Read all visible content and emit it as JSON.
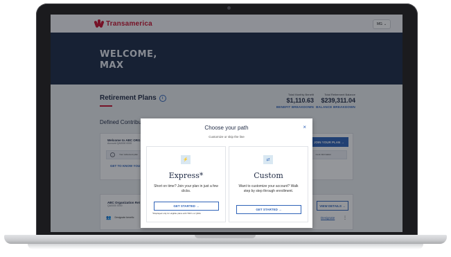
{
  "brand": {
    "name": "Transamerica",
    "accent": "#c8102e",
    "navy": "#1d2b45",
    "link_blue": "#2f63b8"
  },
  "header": {
    "user_initials": "MG",
    "user_chevron": "⌄"
  },
  "hero": {
    "title": "WELCOME, MAX"
  },
  "plans": {
    "title": "Retirement Plans",
    "info_glyph": "i",
    "monthly": {
      "label": "Total Monthly Benefit",
      "value": "$1,110.63",
      "link": "BENEFIT BREAKDOWN"
    },
    "balance": {
      "label": "Total Retirement Balance",
      "value": "$239,311.04",
      "link": "BALANCE BREAKDOWN"
    },
    "section_title": "Defined Contribut",
    "card1": {
      "title": "Welcome to ABC ORG",
      "subtitle": "Account QA0000 0000",
      "notice_left": "Your retirement plan",
      "notice_right": "ment information",
      "link": "GET TO KNOW YOU",
      "join_button": "JOIN YOUR PLAN →"
    },
    "card2": {
      "title": "ABC Organization Ret",
      "subtitle": "QA0000 0000",
      "row_text": "Designate benefic",
      "details_button": "VIEW DETAILS →",
      "designate_link": "Designate",
      "kebab": "⋮"
    }
  },
  "modal": {
    "title": "Choose your path",
    "subtitle": "Customize or skip the line",
    "close": "×",
    "express": {
      "icon": "⚡",
      "title": "Express*",
      "description": "Short on time? Join your plan in just a few clicks.",
      "button": "GET STARTED →",
      "footnote": "*Displayed only for eligible plans with TDF's or QDIA"
    },
    "custom": {
      "icon": "⇄",
      "title": "Custom",
      "description": "Want to customize your account? Walk step by step through enrollment.",
      "button": "GET STARTED →"
    }
  }
}
